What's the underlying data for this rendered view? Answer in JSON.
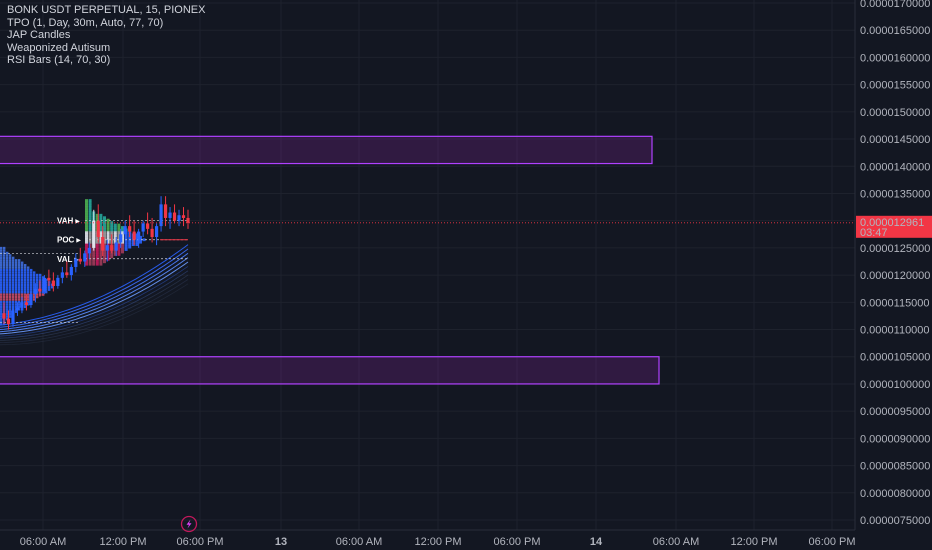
{
  "legend": {
    "title": "BONK USDT PERPETUAL, 15, PIONEX",
    "indicators": [
      "TPO (1, Day, 30m, Auto, 77, 70)",
      "JAP Candles",
      "Weaponized Autisum",
      "RSI Bars (14, 70, 30)"
    ]
  },
  "price_axis": {
    "ticks": [
      "0.0000075000",
      "0.0000080000",
      "0.0000085000",
      "0.0000090000",
      "0.0000095000",
      "0.0000100000",
      "0.0000105000",
      "0.0000110000",
      "0.0000115000",
      "0.0000120000",
      "0.0000125000",
      "0.0000130000",
      "0.0000135000",
      "0.0000140000",
      "0.0000145000",
      "0.0000150000",
      "0.0000155000",
      "0.0000160000",
      "0.0000165000",
      "0.0000170000"
    ],
    "current_price": "0.000012961",
    "countdown": "03:47",
    "current_color": "#f23645"
  },
  "time_axis": {
    "ticks": [
      {
        "label": "06:00 AM",
        "bold": false
      },
      {
        "label": "12:00 PM",
        "bold": false
      },
      {
        "label": "06:00 PM",
        "bold": false
      },
      {
        "label": "13",
        "bold": true
      },
      {
        "label": "06:00 AM",
        "bold": false
      },
      {
        "label": "12:00 PM",
        "bold": false
      },
      {
        "label": "06:00 PM",
        "bold": false
      },
      {
        "label": "14",
        "bold": true
      },
      {
        "label": "06:00 AM",
        "bold": false
      },
      {
        "label": "12:00 PM",
        "bold": false
      },
      {
        "label": "06:00 PM",
        "bold": false
      }
    ]
  },
  "chart_data": {
    "type": "candlestick",
    "y_scale": "linear",
    "ylim": [
      7.5e-06,
      1.7e-05
    ],
    "grid": true,
    "zones": [
      {
        "from": 1.405e-05,
        "to": 1.455e-05,
        "color": "#9c27b0"
      },
      {
        "from": 1e-05,
        "to": 1.05e-05,
        "color": "#9c27b0"
      }
    ],
    "tpo_levels": [
      {
        "label": "VAH",
        "price": 1.3e-05
      },
      {
        "label": "POC",
        "price": 1.265e-05
      },
      {
        "label": "VAL",
        "price": 1.23e-05
      }
    ],
    "candles_ohlc": [
      [
        1.13e-05,
        1.15e-05,
        1.11e-05,
        1.12e-05
      ],
      [
        1.12e-05,
        1.135e-05,
        1.1e-05,
        1.11e-05
      ],
      [
        1.11e-05,
        1.14e-05,
        1.105e-05,
        1.135e-05
      ],
      [
        1.135e-05,
        1.15e-05,
        1.125e-05,
        1.14e-05
      ],
      [
        1.14e-05,
        1.16e-05,
        1.13e-05,
        1.15e-05
      ],
      [
        1.15e-05,
        1.165e-05,
        1.135e-05,
        1.145e-05
      ],
      [
        1.145e-05,
        1.17e-05,
        1.14e-05,
        1.165e-05
      ],
      [
        1.165e-05,
        1.185e-05,
        1.15e-05,
        1.175e-05
      ],
      [
        1.175e-05,
        1.19e-05,
        1.16e-05,
        1.17e-05
      ],
      [
        1.17e-05,
        1.2e-05,
        1.165e-05,
        1.195e-05
      ],
      [
        1.195e-05,
        1.21e-05,
        1.18e-05,
        1.19e-05
      ],
      [
        1.19e-05,
        1.205e-05,
        1.17e-05,
        1.18e-05
      ],
      [
        1.18e-05,
        1.2e-05,
        1.175e-05,
        1.195e-05
      ],
      [
        1.195e-05,
        1.215e-05,
        1.185e-05,
        1.205e-05
      ],
      [
        1.205e-05,
        1.225e-05,
        1.195e-05,
        1.2e-05
      ],
      [
        1.2e-05,
        1.22e-05,
        1.19e-05,
        1.215e-05
      ],
      [
        1.215e-05,
        1.24e-05,
        1.205e-05,
        1.23e-05
      ],
      [
        1.23e-05,
        1.25e-05,
        1.22e-05,
        1.225e-05
      ],
      [
        1.225e-05,
        1.245e-05,
        1.215e-05,
        1.24e-05
      ],
      [
        1.24e-05,
        1.26e-05,
        1.23e-05,
        1.25e-05
      ],
      [
        1.25e-05,
        1.32e-05,
        1.245e-05,
        1.3e-05
      ],
      [
        1.3e-05,
        1.33e-05,
        1.26e-05,
        1.27e-05
      ],
      [
        1.27e-05,
        1.29e-05,
        1.235e-05,
        1.245e-05
      ],
      [
        1.245e-05,
        1.265e-05,
        1.225e-05,
        1.255e-05
      ],
      [
        1.255e-05,
        1.275e-05,
        1.24e-05,
        1.245e-05
      ],
      [
        1.245e-05,
        1.27e-05,
        1.235e-05,
        1.26e-05
      ],
      [
        1.26e-05,
        1.285e-05,
        1.25e-05,
        1.275e-05
      ],
      [
        1.275e-05,
        1.3e-05,
        1.265e-05,
        1.29e-05
      ],
      [
        1.29e-05,
        1.31e-05,
        1.27e-05,
        1.28e-05
      ],
      [
        1.28e-05,
        1.3e-05,
        1.255e-05,
        1.265e-05
      ],
      [
        1.265e-05,
        1.285e-05,
        1.25e-05,
        1.28e-05
      ],
      [
        1.28e-05,
        1.3e-05,
        1.27e-05,
        1.295e-05
      ],
      [
        1.295e-05,
        1.315e-05,
        1.275e-05,
        1.285e-05
      ],
      [
        1.285e-05,
        1.305e-05,
        1.26e-05,
        1.27e-05
      ],
      [
        1.27e-05,
        1.295e-05,
        1.255e-05,
        1.29e-05
      ],
      [
        1.29e-05,
        1.345e-05,
        1.28e-05,
        1.33e-05
      ],
      [
        1.33e-05,
        1.345e-05,
        1.29e-05,
        1.305e-05
      ],
      [
        1.305e-05,
        1.325e-05,
        1.285e-05,
        1.315e-05
      ],
      [
        1.315e-05,
        1.33e-05,
        1.295e-05,
        1.3e-05
      ],
      [
        1.3e-05,
        1.32e-05,
        1.29e-05,
        1.31e-05
      ],
      [
        1.31e-05,
        1.325e-05,
        1.29e-05,
        1.305e-05
      ],
      [
        1.305e-05,
        1.32e-05,
        1.285e-05,
        1.296e-05
      ]
    ]
  }
}
